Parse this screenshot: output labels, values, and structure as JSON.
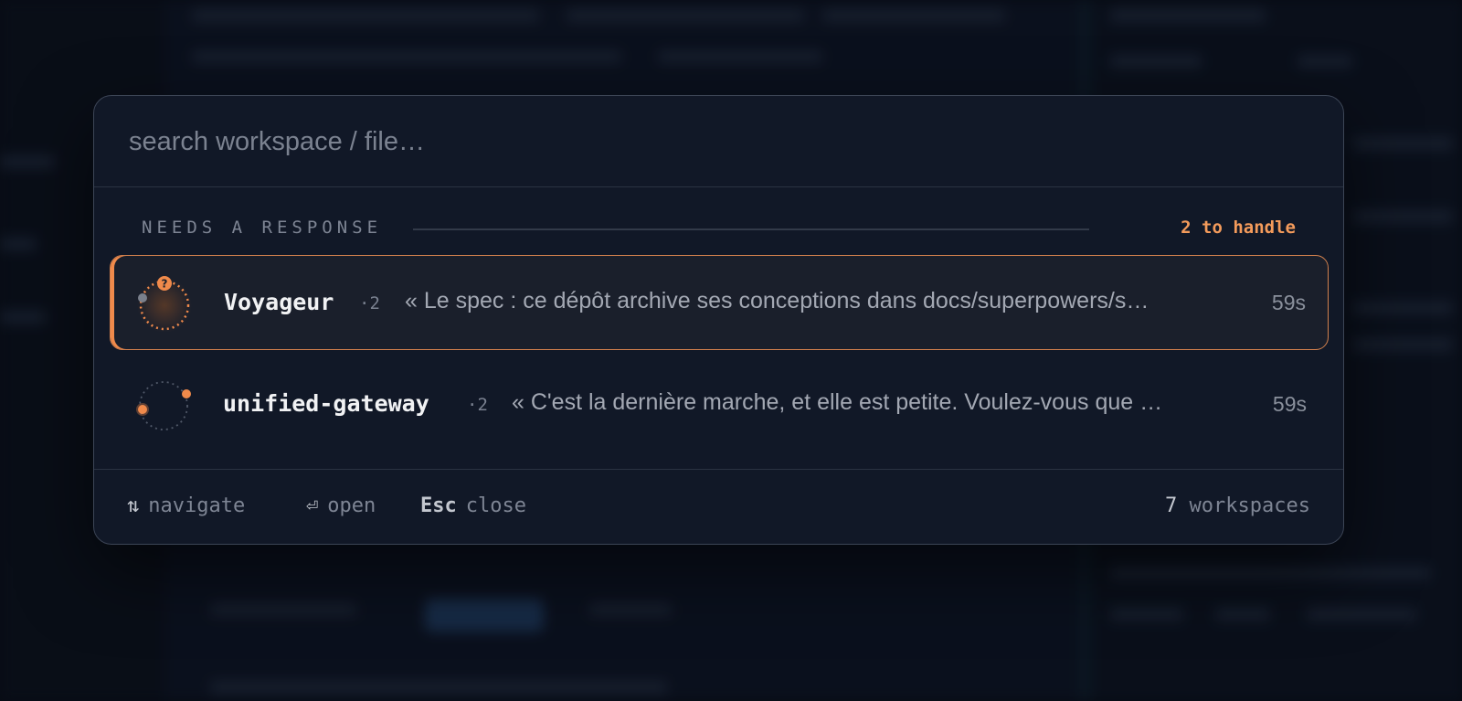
{
  "search": {
    "placeholder": "search workspace / file…"
  },
  "section": {
    "title": "NEEDS A RESPONSE",
    "count_label": "2 to handle"
  },
  "rows": [
    {
      "name": "Voyageur",
      "count": "·2",
      "message": "« Le spec : ce dépôt archive ses conceptions dans docs/superpowers/s…",
      "time": "59s",
      "avatar_badge": "?",
      "selected": true
    },
    {
      "name": "unified-gateway",
      "count": "·2",
      "message": "« C'est la dernière marche, et elle est petite. Voulez-vous que …",
      "time": "59s",
      "selected": false
    }
  ],
  "footer": {
    "hints": [
      {
        "key": "⇅",
        "label": "navigate"
      },
      {
        "key": "⏎",
        "label": "open"
      },
      {
        "key": "Esc",
        "label": "close"
      }
    ],
    "workspace_count": "7",
    "workspace_label": "workspaces"
  },
  "colors": {
    "accent": "#f49b5b",
    "panel": "#111827",
    "border": "#3c4556"
  }
}
